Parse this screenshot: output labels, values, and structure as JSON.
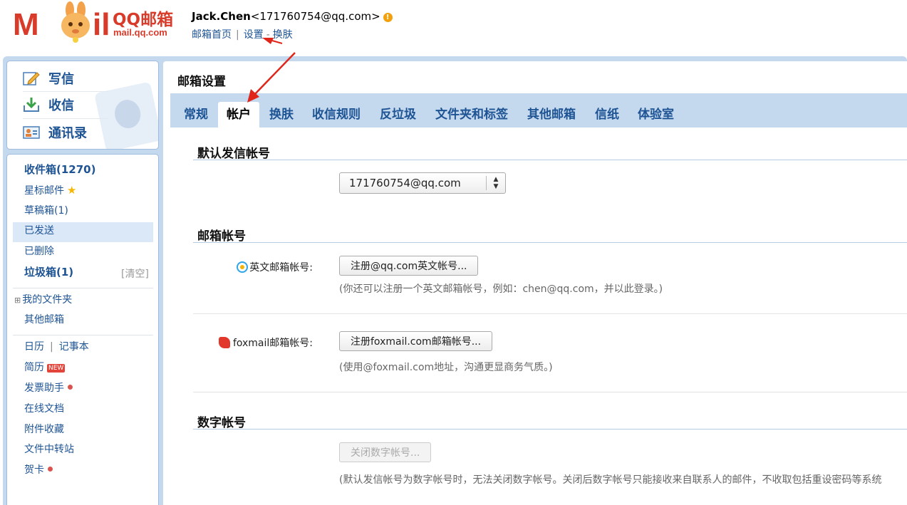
{
  "header": {
    "logo_text": "QQ邮箱",
    "logo_domain": "mail.qq.com",
    "user_name": "Jack.Chen",
    "user_email": "<171760754@qq.com>",
    "links": [
      "邮箱首页",
      "设置",
      "换肤"
    ]
  },
  "quick_actions": [
    {
      "label": "写信",
      "icon": "compose-icon"
    },
    {
      "label": "收信",
      "icon": "inbox-download-icon"
    },
    {
      "label": "通讯录",
      "icon": "contacts-icon"
    }
  ],
  "sidebar": {
    "inbox": "收件箱(1270)",
    "starred": "星标邮件",
    "drafts": "草稿箱(1)",
    "sent": "已发送",
    "deleted": "已删除",
    "spam": "垃圾箱(1)",
    "spam_clear": "[清空]",
    "my_folders": "我的文件夹",
    "other_mailboxes": "其他邮箱",
    "calendar": "日历",
    "notes": "记事本",
    "resume": "简历",
    "resume_badge": "NEW",
    "invoice": "发票助手",
    "docs": "在线文档",
    "attachments": "附件收藏",
    "transfer": "文件中转站",
    "cards": "贺卡"
  },
  "main": {
    "title": "邮箱设置",
    "tabs": [
      "常规",
      "帐户",
      "换肤",
      "收信规则",
      "反垃圾",
      "文件夹和标签",
      "其他邮箱",
      "信纸",
      "体验室"
    ],
    "active_tab": "帐户",
    "default_sender": {
      "title": "默认发信帐号",
      "selected": "171760754@qq.com"
    },
    "mailbox_accounts": {
      "title": "邮箱帐号",
      "english_label": "英文邮箱帐号:",
      "english_button": "注册@qq.com英文帐号...",
      "english_hint": "(你还可以注册一个英文邮箱帐号，例如：chen@qq.com，并以此登录。)",
      "foxmail_label": "foxmail邮箱帐号:",
      "foxmail_button": "注册foxmail.com邮箱帐号...",
      "foxmail_hint": "(使用@foxmail.com地址，沟通更显商务气质。)"
    },
    "numeric_account": {
      "title": "数字帐号",
      "button": "关闭数字帐号...",
      "hint": "(默认发信帐号为数字帐号时，无法关闭数字帐号。关闭后数字帐号只能接收来自联系人的邮件，不收取包括重设密码等系统"
    }
  },
  "colors": {
    "brand_red": "#d93b2a",
    "link_blue": "#1e5494",
    "frame_blue": "#c4d8ee",
    "annotation_red": "#e0261b"
  }
}
